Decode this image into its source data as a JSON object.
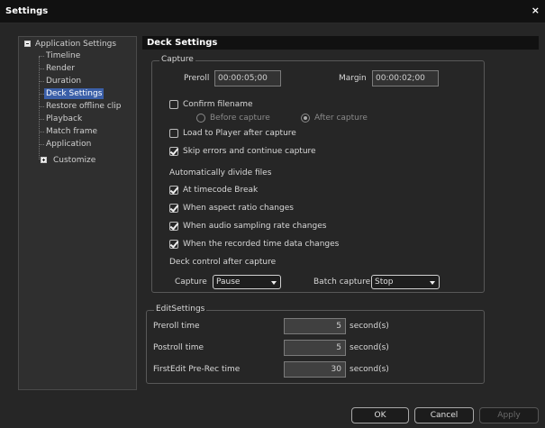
{
  "window": {
    "title": "Settings",
    "close_glyph": "×"
  },
  "tree": {
    "root_label": "Application Settings",
    "children": [
      "Timeline",
      "Render",
      "Duration",
      "Deck Settings",
      "Restore offline clip",
      "Playback",
      "Match frame",
      "Application"
    ],
    "selected": "Deck Settings",
    "customize_label": "Customize"
  },
  "panel": {
    "header": "Deck Settings"
  },
  "capture": {
    "legend": "Capture",
    "preroll_label": "Preroll",
    "preroll_value": "00:00:05;00",
    "margin_label": "Margin",
    "margin_value": "00:00:02;00",
    "confirm_filename": {
      "label": "Confirm filename",
      "checked": false
    },
    "radio_before": {
      "label": "Before capture",
      "selected": false
    },
    "radio_after": {
      "label": "After capture",
      "selected": true
    },
    "load_to_player": {
      "label": "Load to Player after capture",
      "checked": false
    },
    "skip_errors": {
      "label": "Skip errors and continue capture",
      "checked": true
    },
    "auto_divide_label": "Automatically divide files",
    "at_timecode_break": {
      "label": "At timecode Break",
      "checked": true
    },
    "aspect_ratio": {
      "label": "When aspect ratio changes",
      "checked": true
    },
    "audio_sampling": {
      "label": "When audio sampling rate changes",
      "checked": true
    },
    "recorded_time": {
      "label": "When the recorded time data changes",
      "checked": true
    },
    "deck_control_label": "Deck control after capture",
    "capture_label": "Capture",
    "capture_value": "Pause",
    "batch_capture_label": "Batch capture",
    "batch_capture_value": "Stop"
  },
  "edit": {
    "legend": "EditSettings",
    "preroll_time_label": "Preroll time",
    "preroll_time_value": "5",
    "postroll_time_label": "Postroll time",
    "postroll_time_value": "5",
    "firstedit_label": "FirstEdit Pre-Rec time",
    "firstedit_value": "30",
    "unit": "second(s)"
  },
  "buttons": {
    "ok": "OK",
    "cancel": "Cancel",
    "apply": "Apply"
  },
  "colors": {
    "selection": "#3b5fa8",
    "background": "#262626",
    "header": "#111111"
  }
}
